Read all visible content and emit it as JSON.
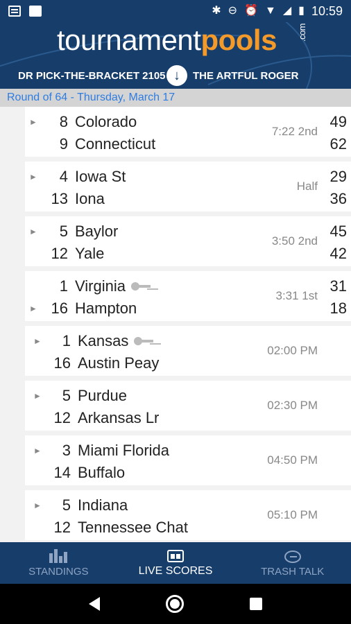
{
  "status_bar": {
    "time": "10:59"
  },
  "header": {
    "logo_part1": "tournament",
    "logo_part2": "pools",
    "logo_suffix": ".com",
    "left_entry": "DR PICK-THE-BRACKET 2105",
    "right_entry": "THE ARTFUL ROGER"
  },
  "round_label": "Round of 64 - Thursday, March 17",
  "games": [
    {
      "team1": {
        "seed": "8",
        "name": "Colorado",
        "score": "49"
      },
      "team2": {
        "seed": "9",
        "name": "Connecticut",
        "score": "62"
      },
      "status": "7:22 2nd",
      "arrow_row": 1
    },
    {
      "team1": {
        "seed": "4",
        "name": "Iowa St",
        "score": "29"
      },
      "team2": {
        "seed": "13",
        "name": "Iona",
        "score": "36"
      },
      "status": "Half",
      "arrow_row": 1
    },
    {
      "team1": {
        "seed": "5",
        "name": "Baylor",
        "score": "45"
      },
      "team2": {
        "seed": "12",
        "name": "Yale",
        "score": "42"
      },
      "status": "3:50 2nd",
      "arrow_row": 1
    },
    {
      "team1": {
        "seed": "1",
        "name": "Virginia",
        "score": "31",
        "key": true
      },
      "team2": {
        "seed": "16",
        "name": "Hampton",
        "score": "18"
      },
      "status": "3:31 1st",
      "arrow_row": 2
    },
    {
      "team1": {
        "seed": "1",
        "name": "Kansas",
        "score": "",
        "key": true
      },
      "team2": {
        "seed": "16",
        "name": "Austin Peay",
        "score": ""
      },
      "status": "02:00 PM",
      "arrow_row": 1
    },
    {
      "team1": {
        "seed": "5",
        "name": "Purdue",
        "score": ""
      },
      "team2": {
        "seed": "12",
        "name": "Arkansas Lr",
        "score": ""
      },
      "status": "02:30 PM",
      "arrow_row": 1
    },
    {
      "team1": {
        "seed": "3",
        "name": "Miami Florida",
        "score": ""
      },
      "team2": {
        "seed": "14",
        "name": "Buffalo",
        "score": ""
      },
      "status": "04:50 PM",
      "arrow_row": 1
    },
    {
      "team1": {
        "seed": "5",
        "name": "Indiana",
        "score": ""
      },
      "team2": {
        "seed": "12",
        "name": "Tennessee Chat",
        "score": ""
      },
      "status": "05:10 PM",
      "arrow_row": 1
    }
  ],
  "tabs": [
    {
      "label": "STANDINGS",
      "icon": "bar-chart-icon",
      "active": false
    },
    {
      "label": "LIVE SCORES",
      "icon": "scoreboard-icon",
      "active": true
    },
    {
      "label": "TRASH TALK",
      "icon": "chat-bubble-icon",
      "active": false
    }
  ]
}
